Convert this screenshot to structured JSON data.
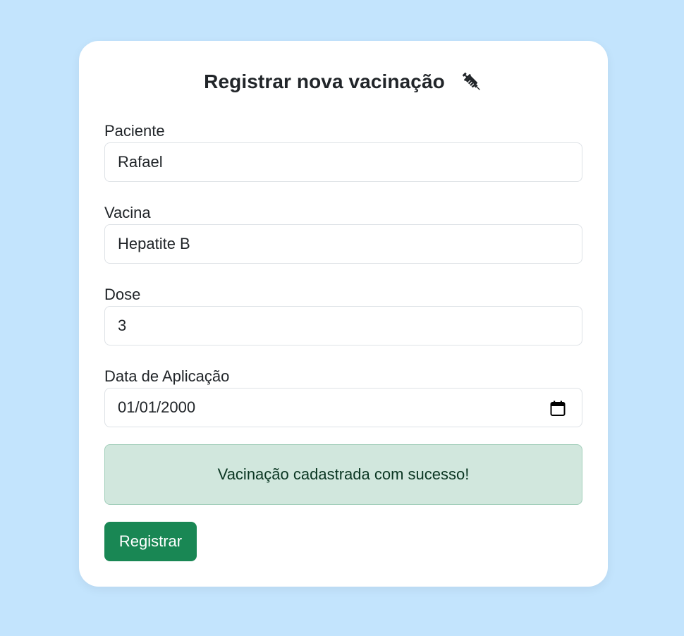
{
  "form": {
    "title": "Registrar nova vacinação",
    "title_icon": "syringe-icon",
    "fields": [
      {
        "label": "Paciente",
        "value": "Rafael"
      },
      {
        "label": "Vacina",
        "value": "Hepatite B"
      },
      {
        "label": "Dose",
        "value": "3"
      },
      {
        "label": "Data de Aplicação",
        "value": "01/01/2000",
        "icon": "calendar-icon"
      }
    ],
    "alert": "Vacinação cadastrada com sucesso!",
    "submit_label": "Registrar"
  },
  "colors": {
    "page_background": "#c3e4fd",
    "alert_background": "#d1e7dd",
    "alert_text": "#0a3622",
    "button": "#198754"
  }
}
